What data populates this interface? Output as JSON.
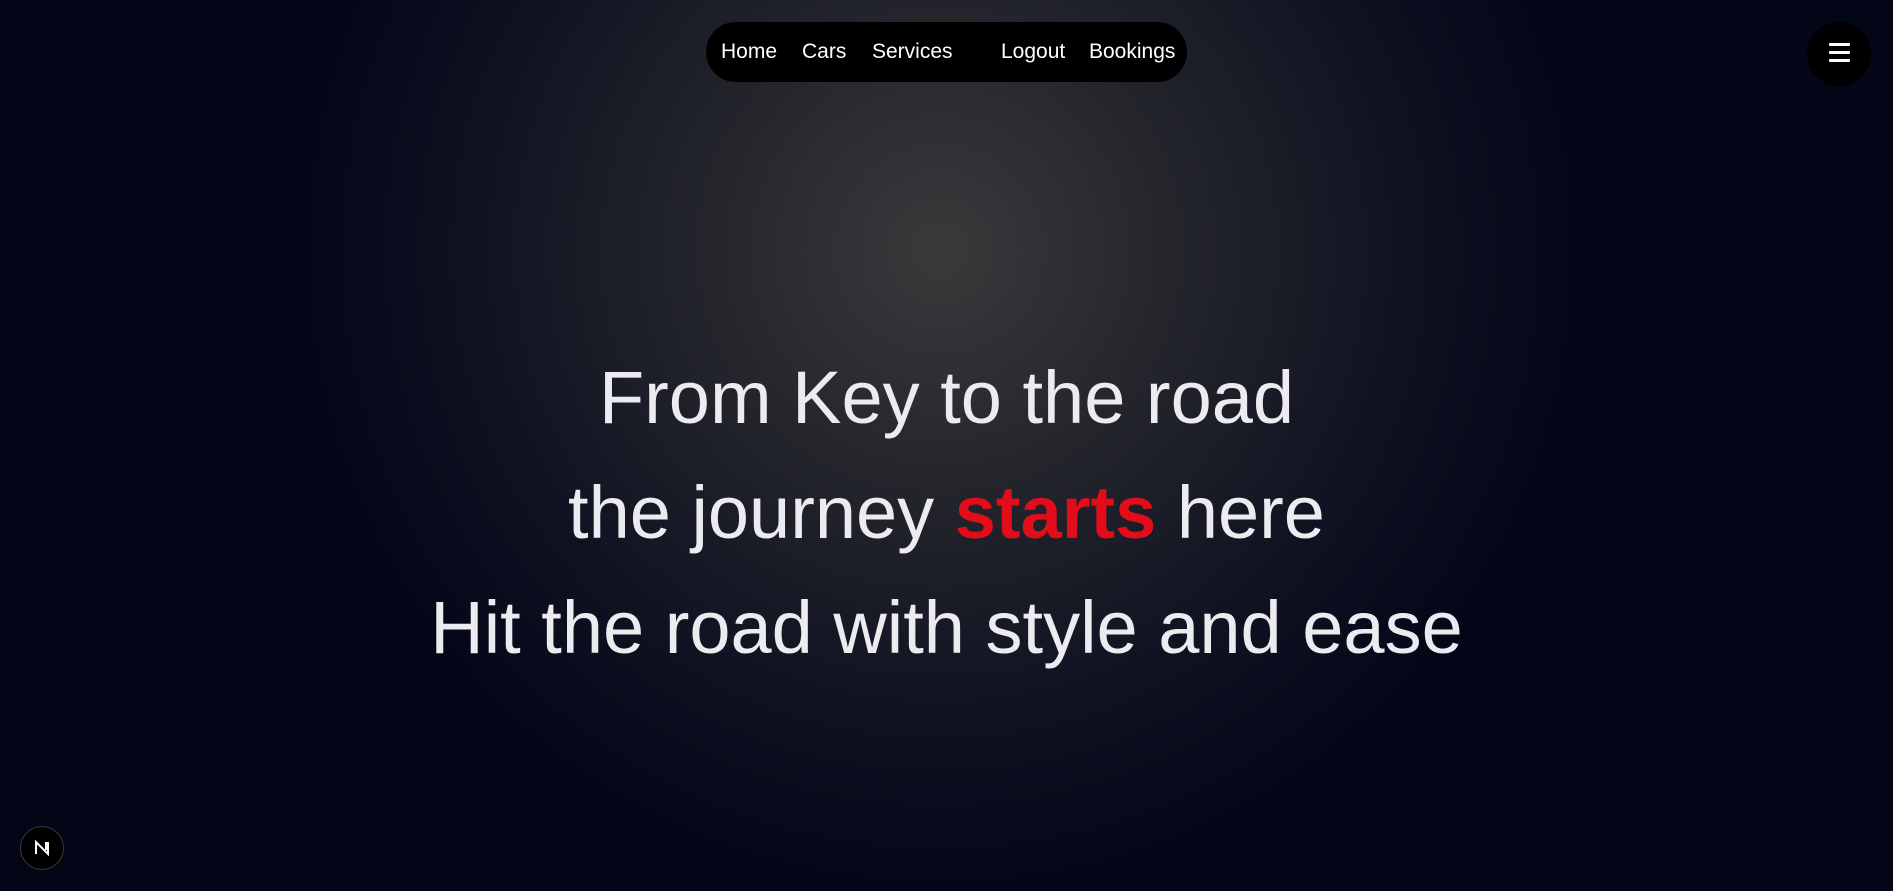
{
  "nav": {
    "items": [
      {
        "label": "Home"
      },
      {
        "label": "Cars"
      },
      {
        "label": "Services"
      },
      {
        "label": "Logout"
      },
      {
        "label": "Bookings"
      }
    ]
  },
  "menu_button": {
    "icon": "hamburger-menu-icon"
  },
  "hero": {
    "line1": "From Key to the road",
    "line2_before": "the journey ",
    "line2_highlight": "starts",
    "line2_after": " here",
    "line3": "Hit the road with style and ease"
  },
  "dev_badge": {
    "icon": "nextjs-logo-icon",
    "label": "N"
  },
  "colors": {
    "accent": "#e10d1a",
    "nav_background": "#000000",
    "hero_text": "#ececf0",
    "background_center": "#3a3a3c",
    "background_edge": "#030617"
  }
}
